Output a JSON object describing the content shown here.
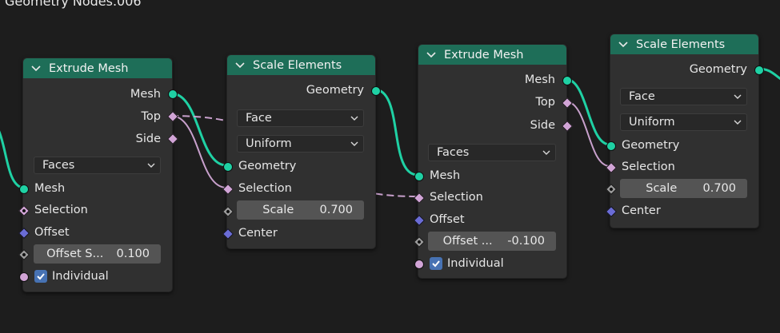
{
  "editor": {
    "tree_name": "Geometry Nodes.006"
  },
  "colors": {
    "header": "#1e6e58",
    "node_body": "#303030",
    "geometry_socket": "#1fd1a4",
    "boolean_socket": "#d1a4d6",
    "vector_socket": "#6a6cd6",
    "float_socket": "#9a9a9a",
    "geometry_wire": "#1fd1a4",
    "boolean_wire": "#c8a0cc",
    "checkbox": "#4772b3"
  },
  "nodes": {
    "extrude1": {
      "title": "Extrude Mesh",
      "out_mesh": "Mesh",
      "out_top": "Top",
      "out_side": "Side",
      "mode": "Faces",
      "in_mesh": "Mesh",
      "in_selection": "Selection",
      "in_offset": "Offset",
      "offset_scale_label": "Offset S...",
      "offset_scale_value": "0.100",
      "individual_label": "Individual",
      "individual_checked": true
    },
    "scale1": {
      "title": "Scale Elements",
      "out_geometry": "Geometry",
      "domain": "Face",
      "scale_mode": "Uniform",
      "in_geometry": "Geometry",
      "in_selection": "Selection",
      "scale_label": "Scale",
      "scale_value": "0.700",
      "in_center": "Center"
    },
    "extrude2": {
      "title": "Extrude Mesh",
      "out_mesh": "Mesh",
      "out_top": "Top",
      "out_side": "Side",
      "mode": "Faces",
      "in_mesh": "Mesh",
      "in_selection": "Selection",
      "in_offset": "Offset",
      "offset_scale_label": "Offset ...",
      "offset_scale_value": "-0.100",
      "individual_label": "Individual",
      "individual_checked": true
    },
    "scale2": {
      "title": "Scale Elements",
      "out_geometry": "Geometry",
      "domain": "Face",
      "scale_mode": "Uniform",
      "in_geometry": "Geometry",
      "in_selection": "Selection",
      "scale_label": "Scale",
      "scale_value": "0.700",
      "in_center": "Center"
    }
  }
}
